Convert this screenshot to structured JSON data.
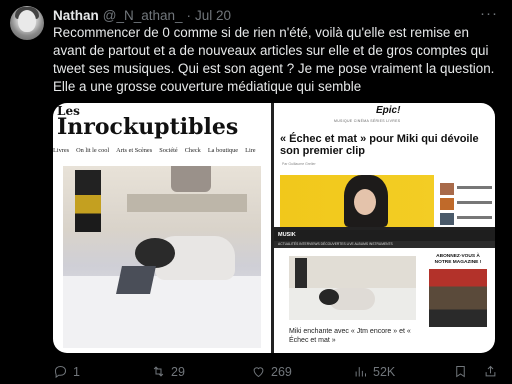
{
  "tweet": {
    "author_name": "Nathan",
    "author_handle": "@_N_athan_",
    "separator": "·",
    "date": "Jul 20",
    "more_icon": "ellipsis-icon",
    "text": "Recommencer de 0 comme si de rien n'été, voilà qu'elle est remise en avant de partout et a de nouveaux articles sur elle et de gros comptes qui tweet ses musiques. Qui est son agent ? Je me pose vraiment la question. Elle a une grosse couverture médiatique qui semble"
  },
  "media": {
    "left": {
      "logo_line1": "Les",
      "logo_line2": "Inrockuptibles",
      "nav": [
        "Livres",
        "On lit le cool",
        "Arts et Scènes",
        "Société",
        "Check",
        "La boutique",
        "Lire"
      ]
    },
    "right_top": {
      "logo": "Epic!",
      "nav": "MUSIQUE   CINÉMA   SÉRIES   LIVRES",
      "title": "« Échec et mat » pour Miki qui dévoile son premier clip",
      "byline": "Par Guillaume Grelier"
    },
    "right_bottom": {
      "logo": "MUSIK",
      "nav": "ACTUALITÉS   INTERVIEWS   DÉCOUVERTES   LIVE   ALBUMS   INSTRUMENTS",
      "caption": "Miki enchante avec « Jtm encore » et « Échec et mat »",
      "ad_text": "ABONNEZ-VOUS À NOTRE MAGAZINE !"
    }
  },
  "actions": {
    "reply": {
      "icon": "reply-icon",
      "count": "1"
    },
    "retweet": {
      "icon": "retweet-icon",
      "count": "29"
    },
    "like": {
      "icon": "heart-icon",
      "count": "269"
    },
    "views": {
      "icon": "views-icon",
      "count": "52K"
    },
    "bookmark": {
      "icon": "bookmark-icon"
    },
    "share": {
      "icon": "share-icon"
    }
  },
  "colors": {
    "background": "#000000",
    "text_primary": "#e7e9ea",
    "text_secondary": "#71767b"
  }
}
